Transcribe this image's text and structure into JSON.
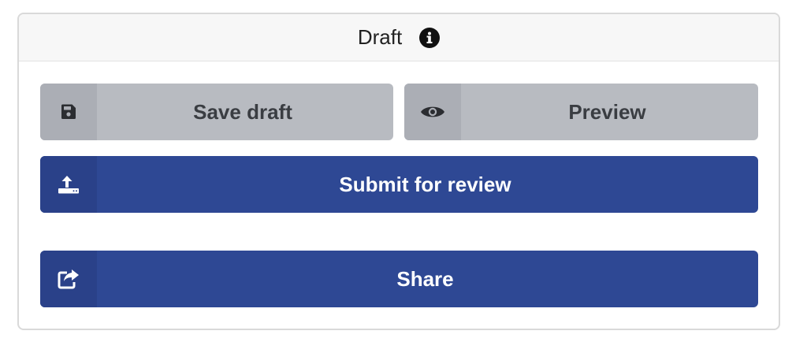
{
  "panel": {
    "title": "Draft",
    "info_icon": "info-circle-icon"
  },
  "buttons": {
    "save_draft": {
      "label": "Save draft",
      "icon": "floppy-disk-icon"
    },
    "preview": {
      "label": "Preview",
      "icon": "eye-icon"
    },
    "submit_for_review": {
      "label": "Submit for review",
      "icon": "upload-icon"
    },
    "share": {
      "label": "Share",
      "icon": "share-icon"
    }
  },
  "colors": {
    "primary": "#2e4894",
    "secondary": "#b8bbc1",
    "header_bg": "#f7f7f7"
  }
}
